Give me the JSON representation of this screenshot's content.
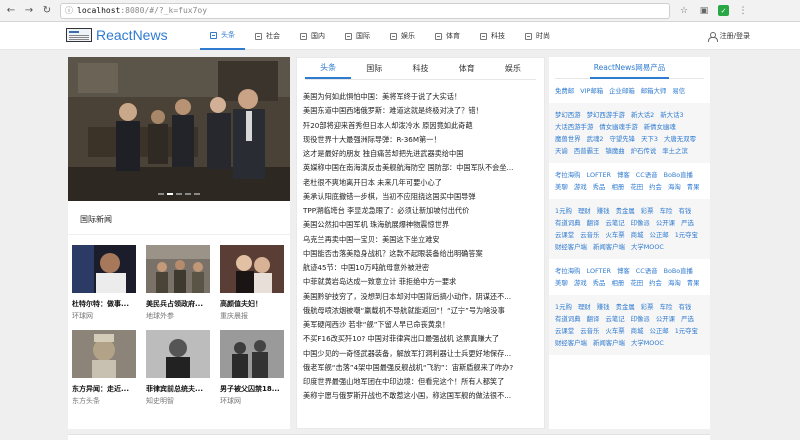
{
  "browser": {
    "url_host": "localhost",
    "url_rest": ":8080/#/?_k=fux7oy"
  },
  "header": {
    "logo_text": "ReactNews",
    "nav": [
      {
        "label": "头条",
        "active": true
      },
      {
        "label": "社会"
      },
      {
        "label": "国内"
      },
      {
        "label": "国际"
      },
      {
        "label": "娱乐"
      },
      {
        "label": "体育"
      },
      {
        "label": "科技"
      },
      {
        "label": "时尚"
      }
    ],
    "auth_label": "注册/登录"
  },
  "left": {
    "section_title": "国际新闻",
    "cards": [
      {
        "caption": "杜特尔特：做事...",
        "source": "环球网"
      },
      {
        "caption": "美民兵占领政府...",
        "source": "地球外参"
      },
      {
        "caption": "高颜值夫妇！",
        "source": "重庆晨报"
      },
      {
        "caption": "东方异闻：走近...",
        "source": "东方头条"
      },
      {
        "caption": "菲律宾前总统夫...",
        "source": "知史明智"
      },
      {
        "caption": "男子被父囚禁18...",
        "source": "环球网"
      }
    ]
  },
  "middle": {
    "tabs": [
      {
        "label": "头条",
        "active": true
      },
      {
        "label": "国际"
      },
      {
        "label": "科技"
      },
      {
        "label": "体育"
      },
      {
        "label": "娱乐"
      }
    ],
    "news": [
      "美国为何如此惧怕中国：美将军终于说了大实话！",
      "美国东道中国西堵俄罗斯：难道这就是终极对决了？错！",
      "歼20部将迎来首秀但日本人却泼冷水 原因竟如此奇葩",
      "现役世界十大最强洲际导弹：R-36M第一！",
      "这才是最好的朋友 独自痛苦却把先进武器卖给中国",
      "英媒称中国在南海演反击美舰航海防空 国防部：中国军队不会坐...",
      "老杜很不爽地离开日本 未来几年可要小心了",
      "美承认阳底撒错一步棋，当初不应阻挠这国买中国导弹",
      "TPP溯临垮台 李显龙急眼了：必须让新加坡付出代价",
      "美国公然扣中国军机 珠海航展爆神物震惊世界",
      "乌克兰再卖中国一宝贝：美国这下坐立难安",
      "中国能否击落美隐身战机？这款不起眼装备给出明确答案",
      "航迹45节：中国10万吨航母意外被泄密",
      "中菲就黄岩岛达成一致意立计 菲拒绝中方一要求",
      "美国黔驴技穷了，没想到日本却对中国背后搞小动作，阴谋还不...",
      "俄航母喷浓烟被嘲“羸载机不导航就能返回”！“辽宁”号为啥没事",
      "美军硬闯西沙 若非“舰”下留人早已命丧黄泉！",
      "不买F16改买歼10? 中国对菲律宾出口最强战机 这票真赚大了",
      "中国少见的一奇怪武器装备，解放军打洞利器让士兵更好地保存...",
      "俄老军舰“击落”4架中国最强反舰战机“飞豹”：宙斯盾舰来了咋办?",
      "印度世界最强山地军团在中印边境：但看完这个！所有人都笑了",
      "美称宁愿与俄罗斯开战也不敢惹这小国，称这国军舰的做法很不..."
    ]
  },
  "right": {
    "title": "ReactNews网易产品",
    "blocks": [
      {
        "alt": false,
        "links": [
          "免费邮",
          "VIP邮箱",
          "企业邮箱",
          "邮箱大师",
          "易信"
        ]
      },
      {
        "alt": true,
        "links": [
          "梦幻西游",
          "梦幻西游手游",
          "新大话2",
          "新大话3",
          "大话西游手游",
          "倩女幽魂手游",
          "新倩女幽魂",
          "魔兽世界",
          "武魂2",
          "守望先锋",
          "天下3",
          "大唐无双零",
          "天谕",
          "西普霸王",
          "镇魔曲",
          "炉石传说",
          "率土之滨"
        ]
      },
      {
        "alt": false,
        "links": [
          "考拉海购",
          "LOFTER",
          "博客",
          "CC语音",
          "BoBo直播",
          "美聊",
          "游戏",
          "秀品",
          "相册",
          "花田",
          "约会",
          "海淘",
          "青果"
        ]
      },
      {
        "alt": true,
        "links": [
          "1元购",
          "理财",
          "赚钱",
          "贵金属",
          "彩票",
          "车险",
          "有钱",
          "有道词典",
          "翻译",
          "云笔记",
          "印像派",
          "公开课",
          "严选",
          "云课堂",
          "云音乐",
          "火车票",
          "商城",
          "公正邮",
          "1元夺宝",
          "财经客户端",
          "新闻客户端",
          "大学MOOC"
        ]
      },
      {
        "alt": false,
        "links": [
          "考拉海购",
          "LOFTER",
          "博客",
          "CC语音",
          "BoBo直播",
          "美聊",
          "游戏",
          "秀品",
          "相册",
          "花田",
          "约会",
          "海淘",
          "青果"
        ]
      },
      {
        "alt": true,
        "links": [
          "1元购",
          "理财",
          "赚钱",
          "贵金属",
          "彩票",
          "车险",
          "有钱",
          "有道词典",
          "翻译",
          "云笔记",
          "印像派",
          "公开课",
          "严选",
          "云课堂",
          "云音乐",
          "火车票",
          "商城",
          "公正邮",
          "1元夺宝",
          "财经客户端",
          "新闻客户端",
          "大学MOOC"
        ]
      }
    ]
  }
}
